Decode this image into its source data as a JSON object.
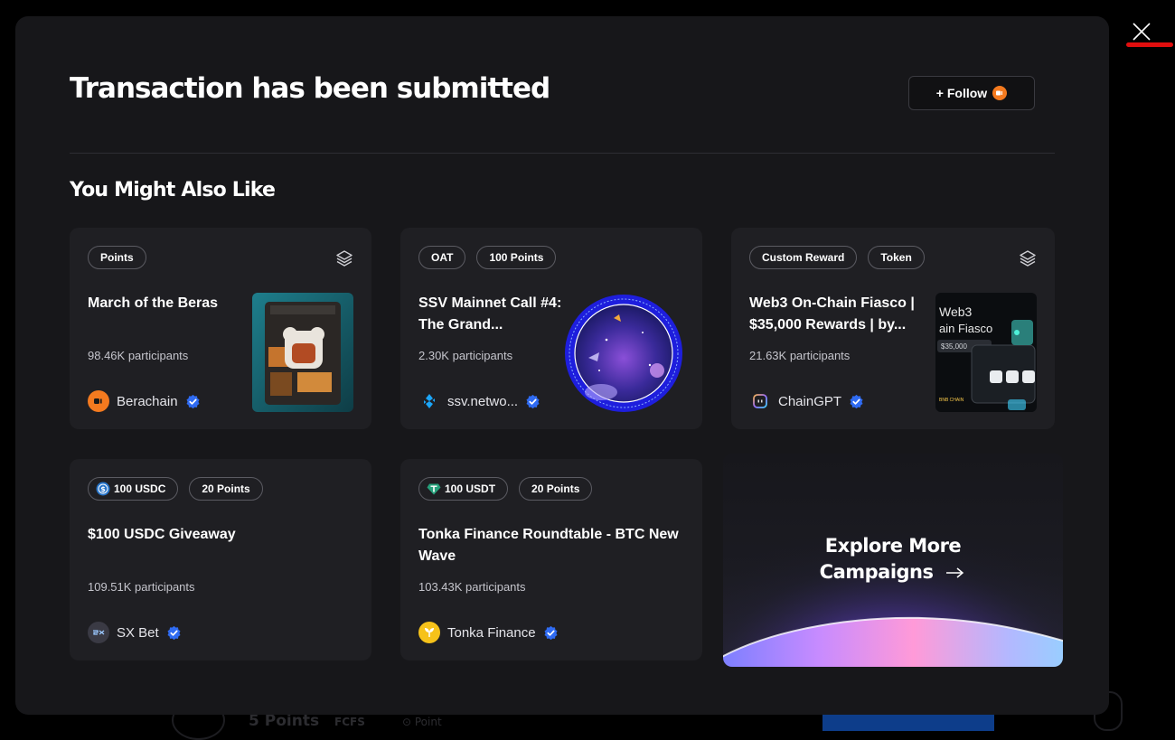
{
  "modal": {
    "title": "Transaction has been submitted",
    "follow_label": "+ Follow",
    "section_title": "You Might Also Like"
  },
  "colors": {
    "modal_bg": "#17171a",
    "card_bg": "#1f1f23",
    "close_highlight": "#e10e0e",
    "verified_badge": "#2f6bf2"
  },
  "cards": [
    {
      "tags": [
        "Points"
      ],
      "title": "March of the Beras",
      "participants": "98.46K participants",
      "owner": "Berachain",
      "owner_icon": "berachain-logo",
      "verified": true,
      "has_layers_icon": true
    },
    {
      "tags": [
        "OAT",
        "100 Points"
      ],
      "title": "SSV Mainnet Call #4: The Grand...",
      "participants": "2.30K participants",
      "owner": "ssv.netwo...",
      "owner_icon": "ssv-network-logo",
      "verified": true,
      "has_layers_icon": false
    },
    {
      "tags": [
        "Custom Reward",
        "Token"
      ],
      "title": "Web3 On-Chain Fiasco | $35,000 Rewards | by...",
      "participants": "21.63K participants",
      "owner": "ChainGPT",
      "owner_icon": "chaingpt-logo",
      "verified": true,
      "has_layers_icon": true
    },
    {
      "tags": [
        "100 USDC",
        "20 Points"
      ],
      "title": "$100 USDC Giveaway",
      "participants": "109.51K participants",
      "owner": "SX Bet",
      "owner_icon": "sx-bet-logo",
      "verified": true
    },
    {
      "tags": [
        "100 USDT",
        "20 Points"
      ],
      "title": "Tonka Finance Roundtable - BTC New Wave",
      "participants": "103.43K participants",
      "owner": "Tonka Finance",
      "owner_icon": "tonka-finance-logo",
      "verified": true
    }
  ],
  "explore": {
    "line1": "Explore More",
    "line2": "Campaigns"
  },
  "background_page": {
    "points": "5 Points",
    "fcfs": "FCFS",
    "point": "Point"
  }
}
